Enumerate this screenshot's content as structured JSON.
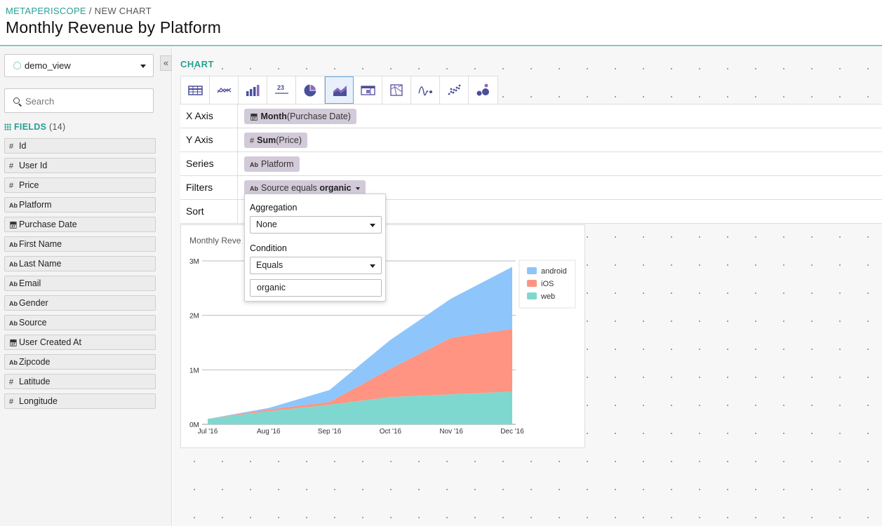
{
  "breadcrumb": {
    "brand": "METAPERISCOPE",
    "sep": " / ",
    "current": "NEW CHART"
  },
  "page_title": "Monthly Revenue by Platform",
  "sidebar": {
    "view": "demo_view",
    "collapse": "«",
    "search_placeholder": "Search",
    "fields_label": "FIELDS",
    "fields_count": "(14)",
    "fields": [
      {
        "icon": "#",
        "name": "Id"
      },
      {
        "icon": "#",
        "name": "User Id"
      },
      {
        "icon": "#",
        "name": "Price"
      },
      {
        "icon": "Ab",
        "name": "Platform"
      },
      {
        "icon": "cal",
        "name": "Purchase Date"
      },
      {
        "icon": "Ab",
        "name": "First Name"
      },
      {
        "icon": "Ab",
        "name": "Last Name"
      },
      {
        "icon": "Ab",
        "name": "Email"
      },
      {
        "icon": "Ab",
        "name": "Gender"
      },
      {
        "icon": "Ab",
        "name": "Source"
      },
      {
        "icon": "cal",
        "name": "User Created At"
      },
      {
        "icon": "Ab",
        "name": "Zipcode"
      },
      {
        "icon": "#",
        "name": "Latitude"
      },
      {
        "icon": "#",
        "name": "Longitude"
      }
    ]
  },
  "main": {
    "chart_label": "CHART",
    "chart_types": [
      "table-icon",
      "line-chart-icon",
      "bar-chart-icon",
      "number-icon",
      "pie-chart-icon",
      "area-chart-icon",
      "pivot-table-icon",
      "map-icon",
      "sparkline-icon",
      "scatter-icon",
      "bubble-icon"
    ],
    "number_icon_text": "23",
    "active_type": "area-chart-icon",
    "rows": {
      "x_axis": {
        "label": "X Axis",
        "icon": "cal",
        "func": "Month",
        "arg": "(Purchase Date)"
      },
      "y_axis": {
        "label": "Y Axis",
        "icon": "#",
        "func": "Sum",
        "arg": "(Price)"
      },
      "series": {
        "label": "Series",
        "icon": "Ab",
        "value": "Platform"
      },
      "filters": {
        "label": "Filters",
        "icon": "Ab",
        "text": "Source equals ",
        "bold": "organic"
      },
      "sort": {
        "label": "Sort"
      }
    }
  },
  "filter_popover": {
    "aggregation_label": "Aggregation",
    "aggregation_value": "None",
    "condition_label": "Condition",
    "condition_value": "Equals",
    "value_input": "organic"
  },
  "chart_data": {
    "type": "area",
    "stacked": true,
    "title": "Monthly Reve",
    "x": [
      "Jul '16",
      "Aug '16",
      "Sep '16",
      "Oct '16",
      "Nov '16",
      "Dec '16"
    ],
    "series": [
      {
        "name": "web",
        "color": "#7fd8cf",
        "values": [
          0.1,
          0.24,
          0.36,
          0.5,
          0.55,
          0.6
        ]
      },
      {
        "name": "iOS",
        "color": "#ff9482",
        "values": [
          0.0,
          0.03,
          0.05,
          0.52,
          1.04,
          1.15
        ]
      },
      {
        "name": "android",
        "color": "#8ec5fb",
        "values": [
          0.0,
          0.03,
          0.22,
          0.53,
          0.72,
          1.14
        ]
      }
    ],
    "legend_order": [
      "android",
      "iOS",
      "web"
    ],
    "yticks": [
      "0M",
      "1M",
      "2M",
      "3M"
    ],
    "ylim": [
      0,
      3
    ],
    "grid": true,
    "legend_position": "top-right"
  }
}
